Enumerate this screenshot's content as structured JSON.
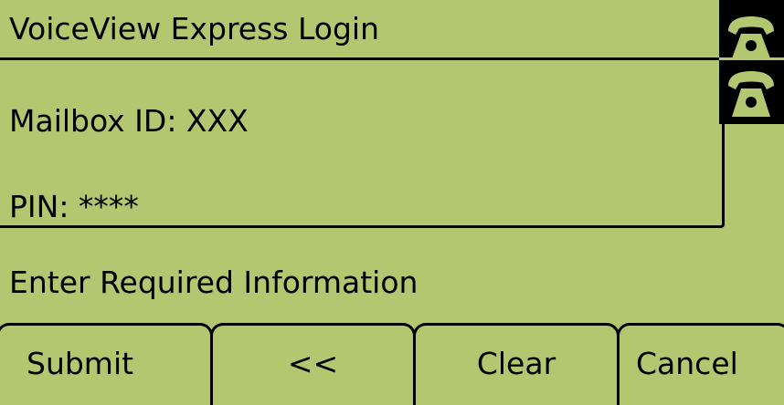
{
  "header": {
    "title": "VoiceView Express Login"
  },
  "form": {
    "mailbox_label": "Mailbox ID: XXX",
    "pin_label": "PIN: ****"
  },
  "status": {
    "message": "Enter Required Information"
  },
  "line_keys": [
    {
      "icon": "phone-handset-icon",
      "state": "on-hook"
    },
    {
      "icon": "phone-handset-icon",
      "state": "on-hook"
    }
  ],
  "softkeys": [
    {
      "label": "Submit"
    },
    {
      "label": "<<"
    },
    {
      "label": "Clear"
    },
    {
      "label": "Cancel"
    }
  ],
  "colors": {
    "screen_background": "#b2c76f",
    "text": "#000000",
    "line_key_background": "#000000"
  }
}
